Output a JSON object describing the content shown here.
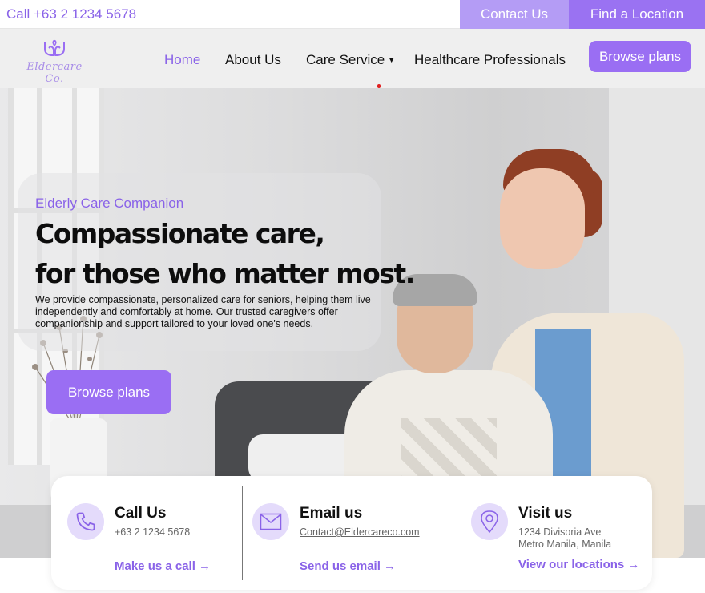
{
  "topbar": {
    "phone": "Call +63 2 1234 5678",
    "contact_button": "Contact Us",
    "location_button": "Find a Location"
  },
  "nav": {
    "logo_text": "Eldercare Co.",
    "links": [
      "Home",
      "About Us",
      "Care Service",
      "Healthcare Professionals"
    ],
    "active": "Home",
    "cta": "Browse plans"
  },
  "hero": {
    "eyebrow": "Elderly Care Companion",
    "headline_line1": "Compassionate care,",
    "headline_line2": "for those who matter most.",
    "description": "We provide compassionate, personalized care for seniors, helping them live independently and comfortably at home. Our trusted caregivers offer companionship and support tailored to your loved one's needs.",
    "cta": "Browse plans"
  },
  "contact_cards": [
    {
      "title": "Call Us",
      "detail": "+63 2 1234 5678",
      "link": "Make us a call →",
      "icon": "phone-icon"
    },
    {
      "title": "Email us",
      "detail": "Contact@Eldercareco.com",
      "link": "Send us email →",
      "icon": "mail-icon"
    },
    {
      "title": "Visit us",
      "detail": "1234 Divisoria Ave",
      "detail2": "Metro Manila, Manila",
      "link": "View our locations →",
      "icon": "location-pin-icon"
    }
  ],
  "colors": {
    "accent": "#9a6ef3",
    "accent_text": "#8a63e8",
    "accent_light": "#b49cf5",
    "icon_bg": "#e4dbfb"
  }
}
